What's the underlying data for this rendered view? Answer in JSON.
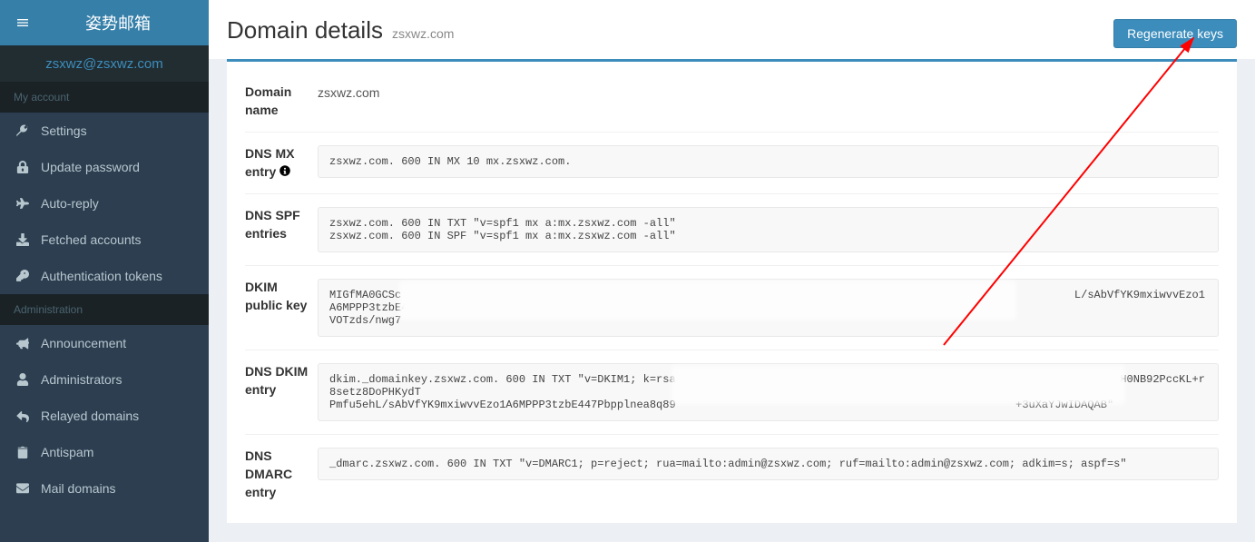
{
  "brand": "姿势邮箱",
  "user_email": "zsxwz@zsxwz.com",
  "section_my_account": "My account",
  "section_administration": "Administration",
  "nav": {
    "settings": "Settings",
    "update_password": "Update password",
    "auto_reply": "Auto-reply",
    "fetched_accounts": "Fetched accounts",
    "auth_tokens": "Authentication tokens",
    "announcement": "Announcement",
    "administrators": "Administrators",
    "relayed_domains": "Relayed domains",
    "antispam": "Antispam",
    "mail_domains": "Mail domains"
  },
  "page": {
    "title": "Domain details",
    "subtitle": "zsxwz.com",
    "regenerate_button": "Regenerate keys"
  },
  "details": {
    "domain_name_label": "Domain name",
    "domain_name_value": "zsxwz.com",
    "mx_label": "DNS MX entry",
    "mx_value": "zsxwz.com. 600 IN MX 10 mx.zsxwz.com.",
    "spf_label": "DNS SPF entries",
    "spf_value": "zsxwz.com. 600 IN TXT \"v=spf1 mx a:mx.zsxwz.com -all\"\nzsxwz.com. 600 IN SPF \"v=spf1 mx a:mx.zsxwz.com -all\"",
    "dkim_pub_label": "DKIM public key",
    "dkim_pub_value": "MIGfMA0GCSc                                                                                                       L/sAbVfYK9mxiwvvEzo1A6MPPP3tzbE447Pbpplnea8q893tUI\nVOTzds/nwg7                                                                                            ",
    "dkim_entry_label": "DNS DKIM entry",
    "dkim_entry_value": "dkim._domainkey.zsxwz.com. 600 IN TXT \"v=DKIM1; k=rsa                                                              pqSIFKH0NB92PccKL+r8setz8DoPHKydT\nPmfu5ehL/sAbVfYK9mxiwvvEzo1A6MPPP3tzbE447Pbpplnea8q89                                                    +3uXaYJwIDAQAB\"",
    "dmarc_label": "DNS DMARC entry",
    "dmarc_value": "_dmarc.zsxwz.com. 600 IN TXT \"v=DMARC1; p=reject; rua=mailto:admin@zsxwz.com; ruf=mailto:admin@zsxwz.com; adkim=s; aspf=s\""
  }
}
